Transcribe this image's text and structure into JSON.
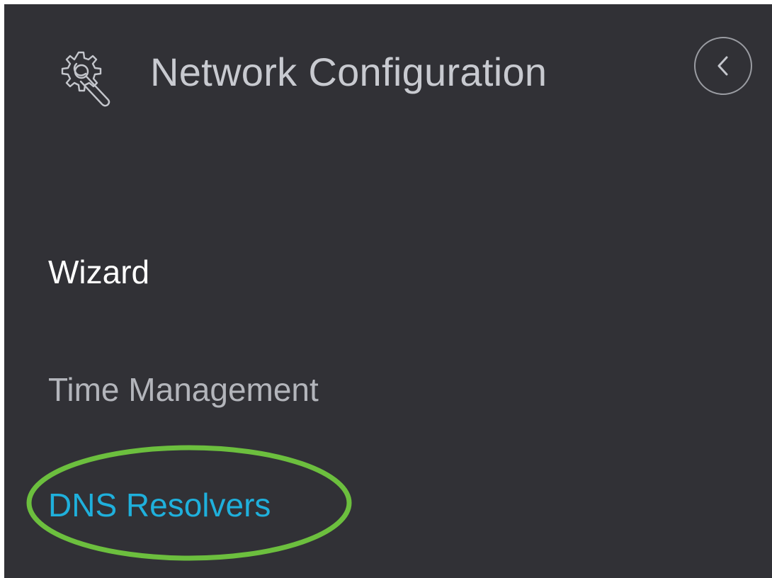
{
  "header": {
    "title": "Network Configuration",
    "icon": "gear-wrench-icon",
    "collapse_icon": "chevron-left-icon"
  },
  "nav": {
    "items": [
      {
        "label": "Wizard",
        "state": "default"
      },
      {
        "label": "Time Management",
        "state": "default"
      },
      {
        "label": "DNS Resolvers",
        "state": "selected"
      }
    ]
  },
  "colors": {
    "background": "#313136",
    "title_text": "#c8cad0",
    "selected_text": "#1fb0dc",
    "annotation_outline": "#6cbf3e"
  }
}
